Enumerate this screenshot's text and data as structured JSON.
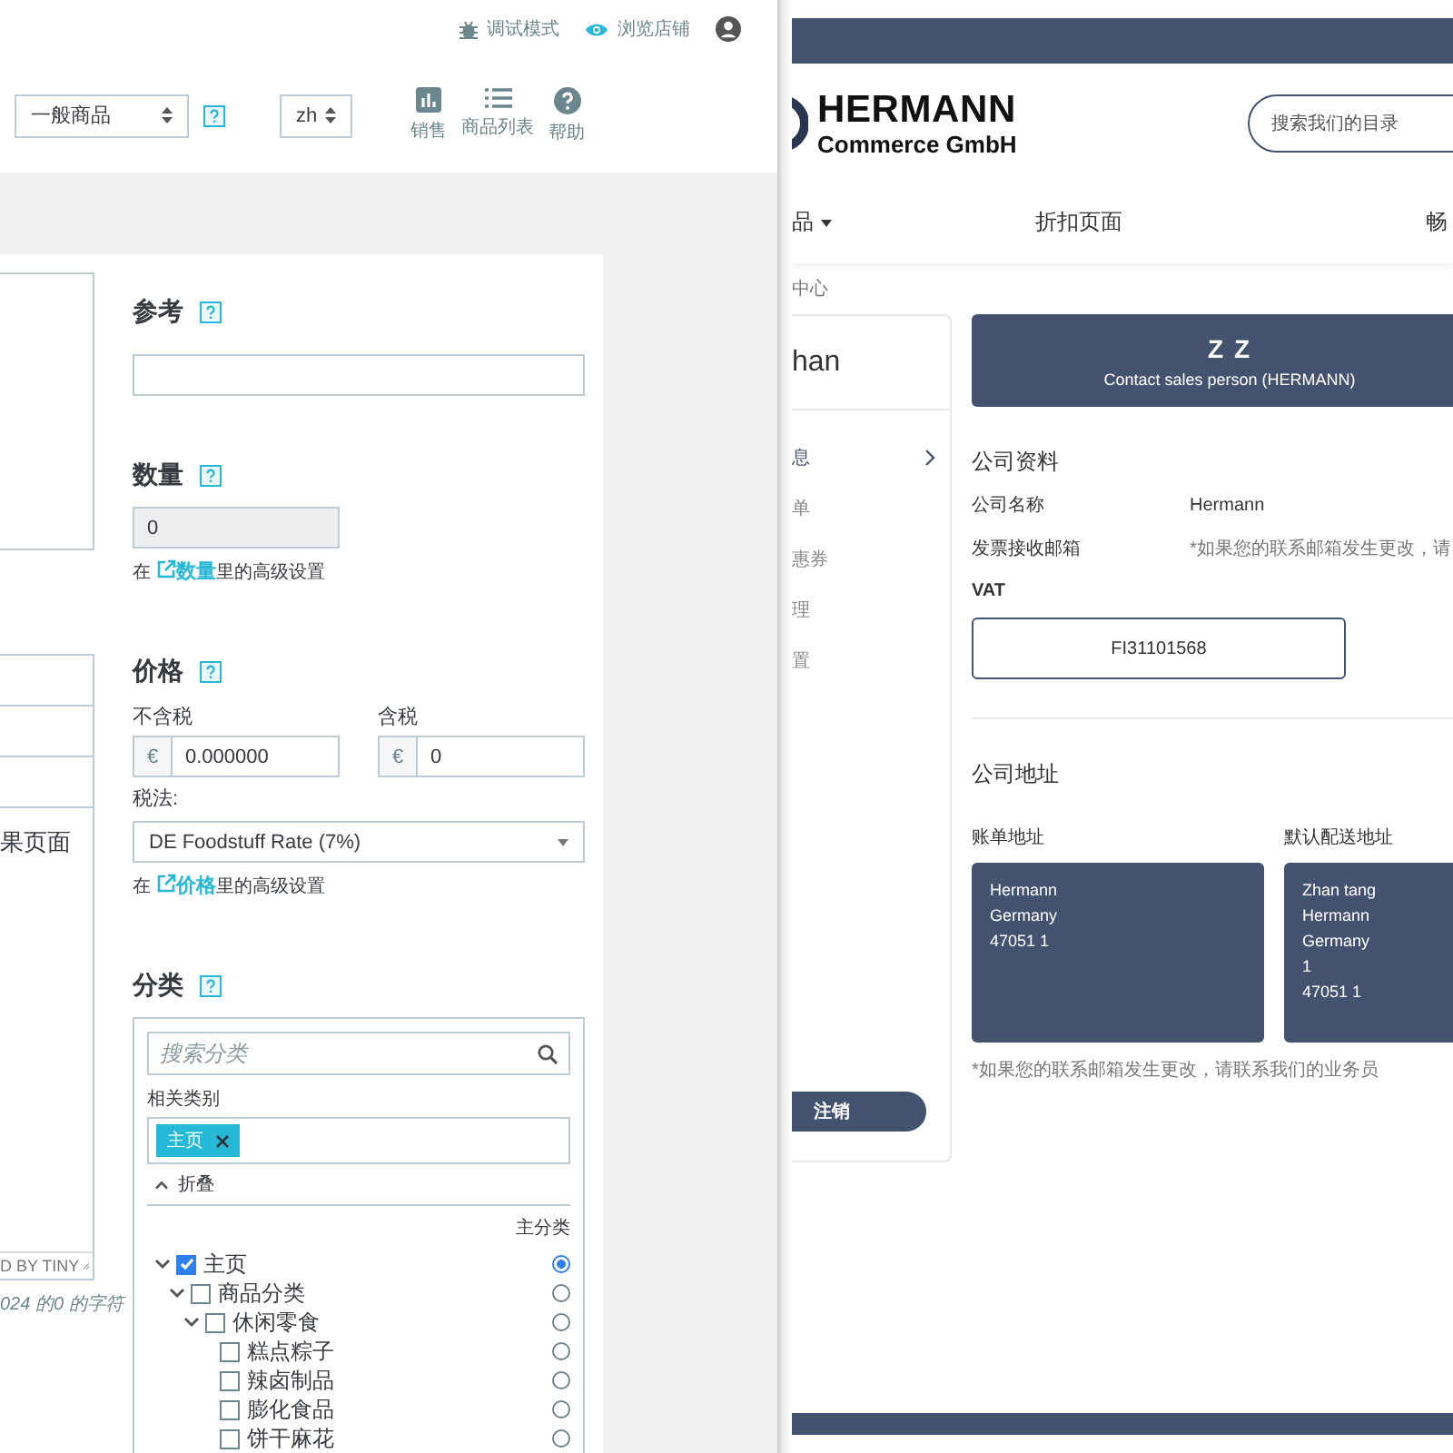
{
  "admin": {
    "header": {
      "debug_mode": "调试模式",
      "view_shop": "浏览店铺"
    },
    "toolbar": {
      "product_type": "一般商品",
      "language": "zh",
      "actions": [
        {
          "kind": "sales",
          "label": "销售"
        },
        {
          "kind": "list",
          "label": "商品列表"
        },
        {
          "kind": "help",
          "label": "帮助"
        }
      ]
    },
    "editor": {
      "row_text": "果页面",
      "status": "D BY TINY",
      "char_count": "024 的0 的字符"
    },
    "reference": {
      "title": "参考"
    },
    "quantity": {
      "title": "数量",
      "value": "0",
      "disabled": true,
      "note": {
        "prefix": "在",
        "link": "数量",
        "suffix": "里的高级设置"
      }
    },
    "price": {
      "title": "价格",
      "excl_label": "不含税",
      "excl_currency": "€",
      "excl_value": "0.000000",
      "incl_label": "含税",
      "incl_currency": "€",
      "incl_value": "0",
      "tax_label": "税法:",
      "tax_rule": "DE Foodstuff Rate (7%)",
      "note": {
        "prefix": "在",
        "link": "价格",
        "suffix": "里的高级设置"
      }
    },
    "categories": {
      "title": "分类",
      "search_placeholder": "搜索分类",
      "related_label": "相关类别",
      "tags": [
        {
          "label": "主页"
        }
      ],
      "collapse_label": "折叠",
      "main_label": "主分类",
      "tree": [
        {
          "label": "主页",
          "checked": true,
          "primary": true,
          "expanded": true,
          "children": [
            {
              "label": "商品分类",
              "checked": false,
              "primary": false,
              "expanded": true,
              "children": [
                {
                  "label": "休闲零食",
                  "checked": false,
                  "primary": false,
                  "expanded": true,
                  "children": [
                    {
                      "label": "糕点粽子",
                      "checked": false,
                      "primary": false
                    },
                    {
                      "label": "辣卤制品",
                      "checked": false,
                      "primary": false
                    },
                    {
                      "label": "膨化食品",
                      "checked": false,
                      "primary": false
                    },
                    {
                      "label": "饼干麻花",
                      "checked": false,
                      "primary": false
                    }
                  ]
                }
              ]
            }
          ]
        }
      ]
    }
  },
  "shop": {
    "logo": {
      "name": "HERMANN",
      "subtitle": "Commerce GmbH"
    },
    "search_placeholder": "搜索我们的目录",
    "nav": [
      {
        "label": "品",
        "kind": "dropdown"
      },
      {
        "label": "折扣页面",
        "kind": "link"
      },
      {
        "label": "畅",
        "kind": "link"
      }
    ],
    "breadcrumb": "中心",
    "account": {
      "name": "han",
      "items": [
        {
          "label": "息",
          "selected": true
        },
        {
          "label": "单",
          "selected": false
        },
        {
          "label": "惠券",
          "selected": false
        },
        {
          "label": "理",
          "selected": false
        },
        {
          "label": "置",
          "selected": false
        }
      ],
      "logout": "注销"
    },
    "sales_contact": {
      "initials": "Z Z",
      "caption": "Contact sales person (HERMANN)"
    },
    "company": {
      "title": "公司资料",
      "fields": [
        {
          "kind": "text",
          "label": "公司名称",
          "value": "Hermann"
        },
        {
          "kind": "note",
          "label": "发票接收邮箱",
          "value": "*如果您的联系邮箱发生更改，请"
        }
      ],
      "vat_label": "VAT",
      "vat_value": "FI31101568"
    },
    "address": {
      "title": "公司地址",
      "cards": [
        {
          "title": "账单地址",
          "lines": [
            "Hermann",
            "Germany",
            "47051 1"
          ]
        },
        {
          "title": "默认配送地址",
          "lines": [
            "Zhan tang",
            "Hermann",
            "Germany",
            "1",
            "47051 1"
          ]
        }
      ],
      "note": "*如果您的联系邮箱发生更改，请联系我们的业务员"
    }
  }
}
